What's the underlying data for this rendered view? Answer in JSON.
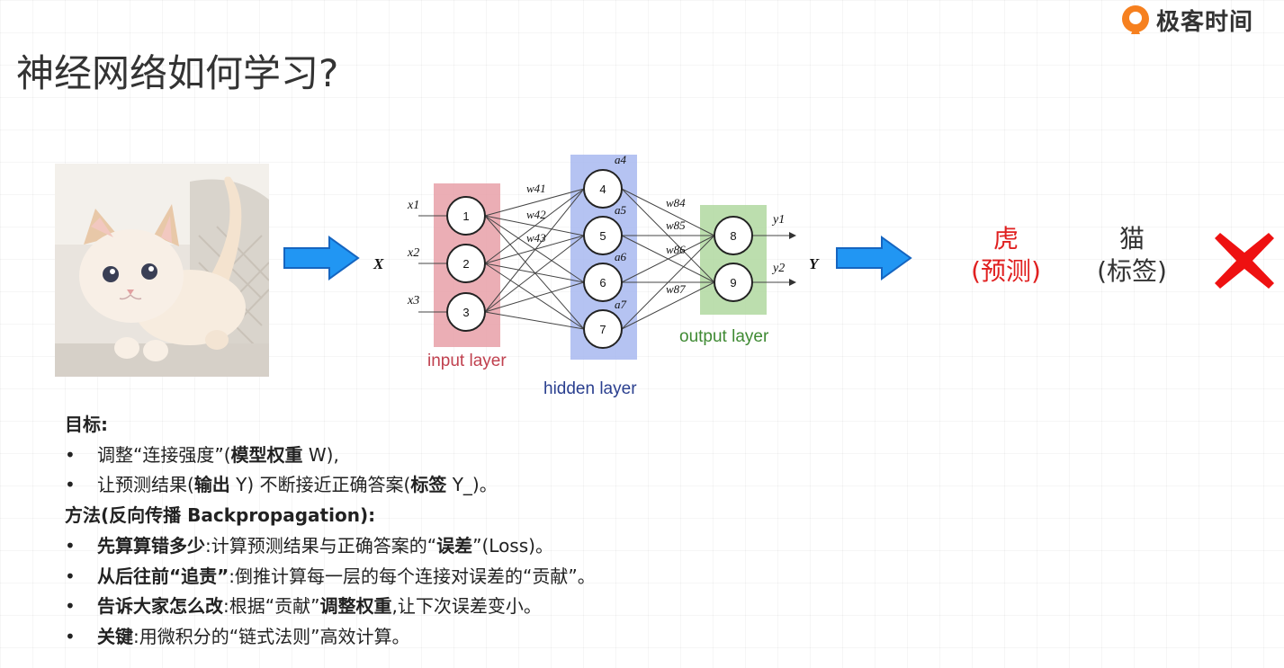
{
  "brand": {
    "name": "极客时间"
  },
  "slide": {
    "title": "神经网络如何学习?"
  },
  "diagram": {
    "inputs": [
      "x1",
      "x2",
      "x3"
    ],
    "input_nodes": [
      "1",
      "2",
      "3"
    ],
    "hidden_nodes": [
      "4",
      "5",
      "6",
      "7"
    ],
    "hidden_acts": [
      "a4",
      "a5",
      "a6",
      "a7"
    ],
    "output_nodes": [
      "8",
      "9"
    ],
    "outputs": [
      "y1",
      "y2"
    ],
    "weights": [
      "w41",
      "w42",
      "w43",
      "w84",
      "w85",
      "w86",
      "w87"
    ],
    "input_label": "input layer",
    "hidden_label": "hidden layer",
    "output_label": "output layer",
    "x_symbol": "X",
    "y_symbol": "Y",
    "colors": {
      "input": "#e8a0a8",
      "hidden": "#a8b8f0",
      "output": "#b0d8a0",
      "arrow": "#2196f3"
    }
  },
  "comparison": {
    "prediction_word": "虎",
    "prediction_tag": "(预测)",
    "label_word": "猫",
    "label_tag": "(标签)",
    "mark_icon": "cross-mark-icon",
    "mark_color": "#ee1111"
  },
  "content": {
    "goal_heading": "目标:",
    "goal_items": [
      {
        "pre": "调整“连接强度”(",
        "bold": "模型权重",
        "post": " W),",
        "bold2": "",
        "post2": ""
      },
      {
        "pre": "让预测结果(",
        "bold": "输出",
        "post": " Y) 不断接近正确答案(",
        "bold2": "标签",
        "post2": " Y_)。"
      }
    ],
    "method_heading": "方法(反向传播 Backpropagation):",
    "method_items": [
      {
        "bold": "先算算错多少",
        "mid": ":计算预测结果与正确答案的“",
        "bold2": "误差",
        "post": "”(Loss)。"
      },
      {
        "bold": "从后往前“追责”",
        "mid": ":倒推计算每一层的每个连接对误差的“贡献”。",
        "bold2": "",
        "post": ""
      },
      {
        "bold": "告诉大家怎么改",
        "mid": ":根据“贡献”",
        "bold2": "调整权重",
        "post": ",让下次误差变小。"
      },
      {
        "bold": "关键",
        "mid": ":用微积分的“链式法则”高效计算。",
        "bold2": "",
        "post": ""
      }
    ]
  }
}
